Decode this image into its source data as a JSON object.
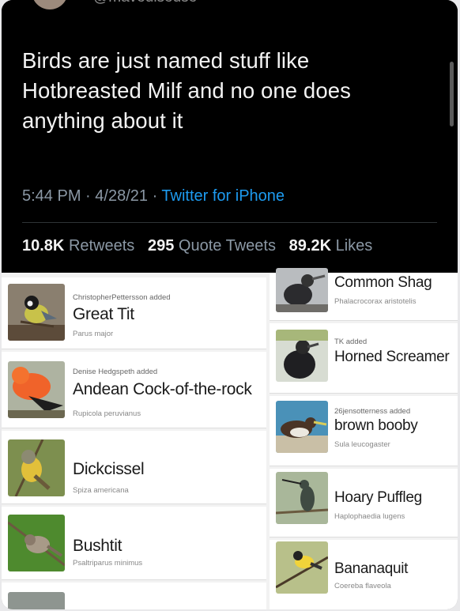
{
  "tweet": {
    "handle": "@maveuiseuse",
    "text": "Birds are just named stuff like Hotbreasted Milf and no one does anything about it",
    "time": "5:44 PM",
    "date": "4/28/21",
    "client": "Twitter for iPhone",
    "retweets_count": "10.8K",
    "retweets_label": "Retweets",
    "quotes_count": "295",
    "quotes_label": "Quote Tweets",
    "likes_count": "89.2K",
    "likes_label": "Likes"
  },
  "birds_left": [
    {
      "added": "ChristopherPettersson added",
      "name": "Great Tit",
      "sci": "Parus major"
    },
    {
      "added": "Denise Hedgspeth added",
      "name": "Andean Cock-of-the-rock",
      "sci": "Rupicola peruvianus"
    },
    {
      "added": "",
      "name": "Dickcissel",
      "sci": "Spiza americana"
    },
    {
      "added": "",
      "name": "Bushtit",
      "sci": "Psaltriparus minimus"
    }
  ],
  "birds_right": [
    {
      "added": "",
      "name": "Common Shag",
      "sci": "Phalacrocorax aristotelis"
    },
    {
      "added": "TK added",
      "name": "Horned Screamer",
      "sci": ""
    },
    {
      "added": "26jensotterness added",
      "name": "brown booby",
      "sci": "Sula leucogaster"
    },
    {
      "added": "",
      "name": "Hoary Puffleg",
      "sci": "Haplophaedia lugens"
    },
    {
      "added": "",
      "name": "Bananaquit",
      "sci": "Coereba flaveola"
    }
  ],
  "colors": {
    "link": "#1d9bf0",
    "muted": "#8b98a5",
    "background": "#000000"
  }
}
